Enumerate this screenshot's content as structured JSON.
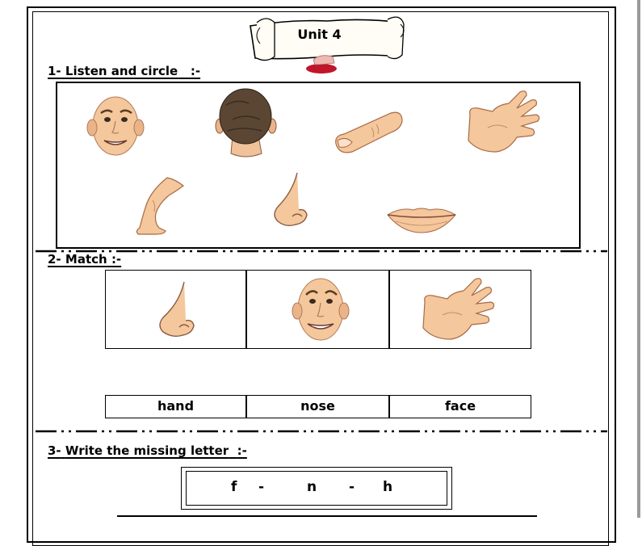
{
  "title": "Unit 4",
  "sections": [
    {
      "number": "1-",
      "label": "Listen and circle",
      "suffix": ":-"
    },
    {
      "number": "2-",
      "label": "Match",
      "suffix": ":-"
    },
    {
      "number": "3-",
      "label": "Write the missing letter",
      "suffix": ":-"
    }
  ],
  "match_words": [
    "hand",
    "nose",
    "face"
  ],
  "missing_letters": [
    "f",
    "-",
    "n",
    "-",
    "h"
  ],
  "colors": {
    "skin": "#f4c79c",
    "skin_shadow": "#d9946a",
    "hair": "#5a4632",
    "lips": "#d8735f",
    "ink": "#000000",
    "blob": "#c0152a"
  },
  "icons": [
    "scroll-banner-icon",
    "face-icon",
    "head-back-icon",
    "finger-icon",
    "hand-icon",
    "leg-icon",
    "nose-icon",
    "lips-icon"
  ]
}
